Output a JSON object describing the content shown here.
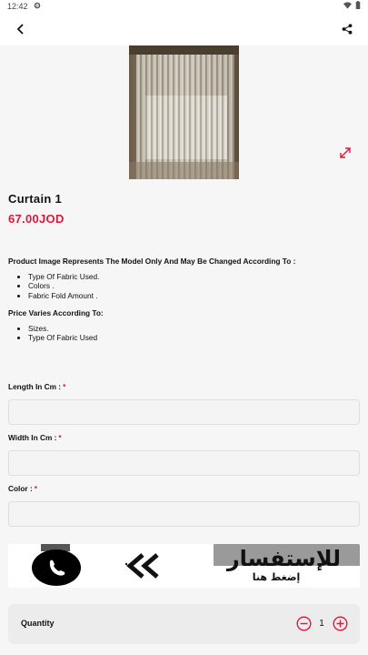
{
  "status_bar": {
    "time": "12:42",
    "icons": [
      "gear-icon",
      "wifi-icon",
      "battery-icon"
    ]
  },
  "app_bar": {
    "icons": [
      "back-arrow-icon",
      "share-icon"
    ]
  },
  "product": {
    "title": "Curtain 1",
    "price": "67.00JOD"
  },
  "description": {
    "heading1": "Product Image Represents The Model Only And May Be Changed According To :",
    "list1": [
      "Type Of Fabric Used.",
      "Colors .",
      "Fabric Fold Amount ."
    ],
    "heading2": "Price Varies According To:",
    "list2": [
      "Sizes.",
      "Type Of Fabric Used"
    ]
  },
  "form": {
    "length_label": "Length In Cm :",
    "width_label": "Width In Cm :",
    "color_label": "Color :",
    "required_mark": "*",
    "length_value": "",
    "width_value": "",
    "color_value": ""
  },
  "banner": {
    "title": "للإستفسار",
    "subtitle": "إضغط هنا"
  },
  "quantity": {
    "label": "Quantity",
    "value": "1"
  },
  "colors": {
    "accent": "#e0173a",
    "background": "#f6f6f6"
  }
}
